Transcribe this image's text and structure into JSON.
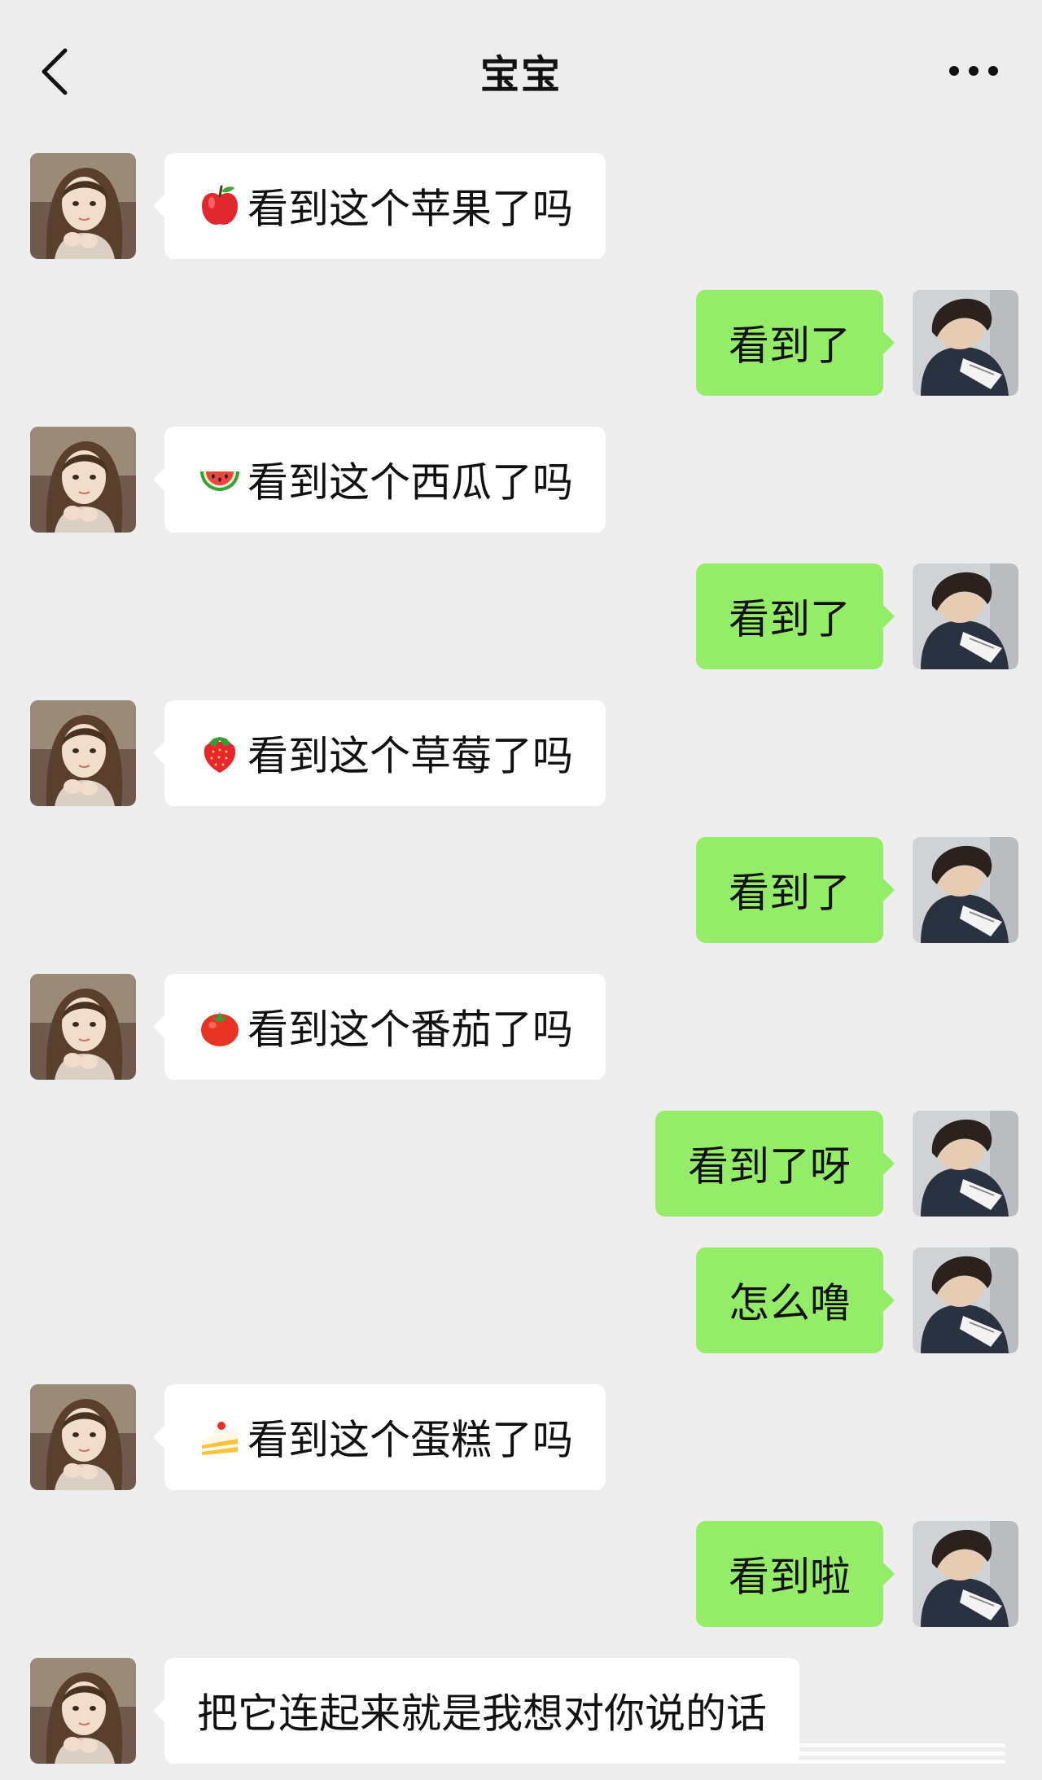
{
  "header": {
    "title": "宝宝",
    "back_icon": "chevron-left-icon",
    "more_icon": "ellipsis-icon"
  },
  "colors": {
    "background": "#ededed",
    "sent_bubble": "#95ec69",
    "received_bubble": "#ffffff"
  },
  "messages": [
    {
      "from": "contact",
      "emoji": "apple",
      "text": "看到这个苹果了吗"
    },
    {
      "from": "me",
      "text": "看到了"
    },
    {
      "from": "contact",
      "emoji": "watermelon",
      "text": "看到这个西瓜了吗"
    },
    {
      "from": "me",
      "text": "看到了"
    },
    {
      "from": "contact",
      "emoji": "strawberry",
      "text": "看到这个草莓了吗"
    },
    {
      "from": "me",
      "text": "看到了"
    },
    {
      "from": "contact",
      "emoji": "tomato",
      "text": "看到这个番茄了吗"
    },
    {
      "from": "me",
      "text": "看到了呀"
    },
    {
      "from": "me",
      "text": "怎么噜"
    },
    {
      "from": "contact",
      "emoji": "cake",
      "text": "看到这个蛋糕了吗"
    },
    {
      "from": "me",
      "text": "看到啦"
    },
    {
      "from": "contact",
      "text": "把它连起来就是我想对你说的话"
    }
  ]
}
